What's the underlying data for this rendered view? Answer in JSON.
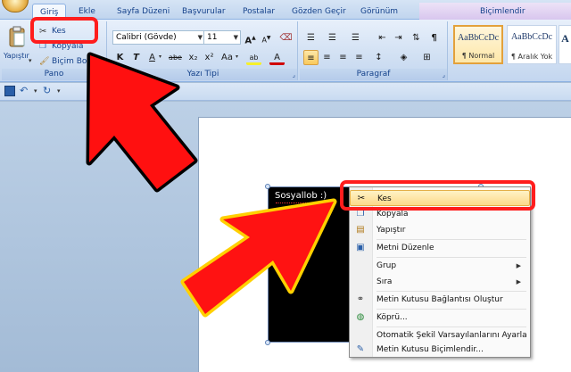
{
  "tabs": [
    {
      "label": "Giriş",
      "active": true
    },
    {
      "label": "Ekle"
    },
    {
      "label": "Sayfa Düzeni"
    },
    {
      "label": "Başvurular"
    },
    {
      "label": "Postalar"
    },
    {
      "label": "Gözden Geçir"
    },
    {
      "label": "Görünüm"
    },
    {
      "label": "Biçimlendir"
    }
  ],
  "clipboard": {
    "group_label": "Pano",
    "paste": "Yapıştır",
    "cut": "Kes",
    "copy": "Kopyala",
    "format_painter": "Biçim Boyac"
  },
  "font": {
    "group_label": "Yazı Tipi",
    "font_name": "Calibri (Gövde)",
    "font_size": "11",
    "bold": "K",
    "italic": "T",
    "underline": "A",
    "strike": "abe",
    "subscript": "x₂",
    "superscript": "x²",
    "change_case": "Aa",
    "grow": "A",
    "shrink": "A",
    "highlight": "ab",
    "color": "A"
  },
  "paragraph": {
    "group_label": "Paragraf"
  },
  "styles": [
    {
      "sample": "AaBbCcDc",
      "name": "¶ Normal",
      "selected": true
    },
    {
      "sample": "AaBbCcDc",
      "name": "¶ Aralık Yok"
    },
    {
      "sample": "A",
      "name": ""
    }
  ],
  "document": {
    "textbox_text": "Sosyallob :)"
  },
  "context_menu": {
    "items": [
      {
        "label": "Kes",
        "icon": "scissors-icon",
        "highlight": true
      },
      {
        "label": "Kopyala",
        "icon": "copy-icon"
      },
      {
        "label": "Yapıştır",
        "icon": "paste-icon"
      },
      {
        "label": "Metni Düzenle",
        "icon": "edit-text-icon"
      },
      {
        "label": "Grup",
        "submenu": true
      },
      {
        "label": "Sıra",
        "submenu": true
      },
      {
        "label": "Metin Kutusu Bağlantısı Oluştur",
        "icon": "link-icon"
      },
      {
        "label": "Köprü...",
        "icon": "globe-icon"
      },
      {
        "label": "Otomatik Şekil Varsayılanlarını Ayarla"
      },
      {
        "label": "Metin Kutusu Biçimlendir...",
        "icon": "format-icon"
      }
    ]
  },
  "colors": {
    "accent": "#ff1d1d",
    "arrow_fill": "#ff1010",
    "ribbon": "#d1e0f3"
  }
}
